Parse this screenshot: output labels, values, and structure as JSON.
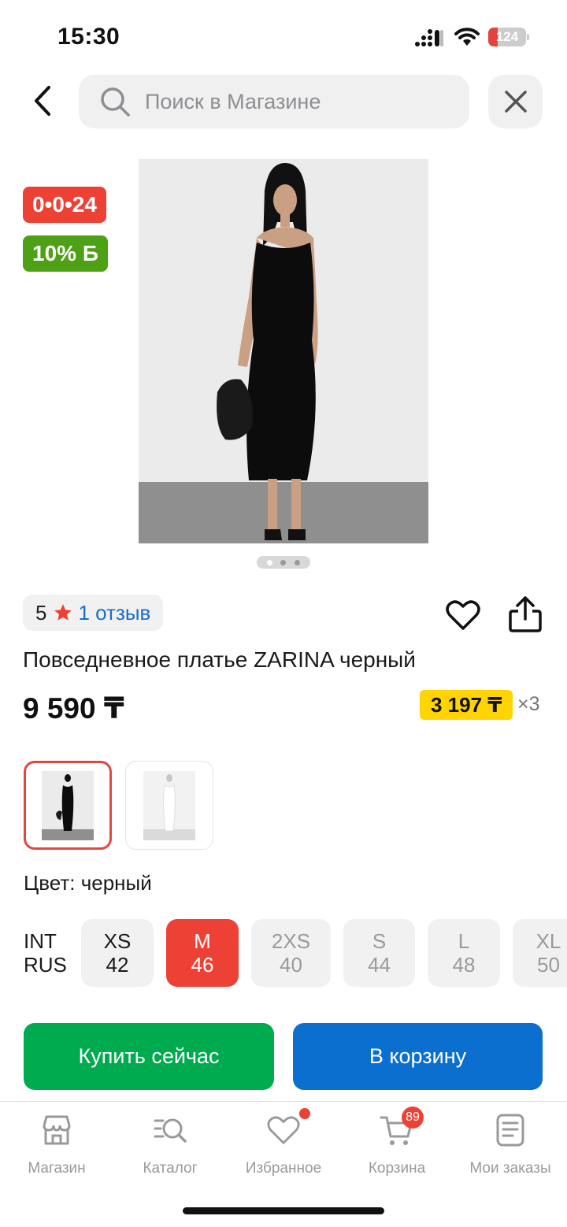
{
  "status_bar": {
    "time": "15:30",
    "battery": "124",
    "battery_level": 0.24
  },
  "search": {
    "placeholder": "Поиск в Магазине"
  },
  "badges": {
    "timer": "0•0•24",
    "bonus": "10% Б"
  },
  "rating": {
    "score": "5",
    "reviews": "1 отзыв"
  },
  "product": {
    "title": "Повседневное платье ZARINA черный",
    "price": "9 590 ₸",
    "installment": "3 197 ₸",
    "installment_multiplier": "×3",
    "color_label": "Цвет: черный"
  },
  "sizes": {
    "scale_int": "INT",
    "scale_rus": "RUS",
    "items": [
      {
        "int": "XS",
        "rus": "42",
        "state": "available"
      },
      {
        "int": "M",
        "rus": "46",
        "state": "selected"
      },
      {
        "int": "2XS",
        "rus": "40",
        "state": "unavailable"
      },
      {
        "int": "S",
        "rus": "44",
        "state": "unavailable"
      },
      {
        "int": "L",
        "rus": "48",
        "state": "unavailable"
      },
      {
        "int": "XL",
        "rus": "50",
        "state": "unavailable"
      }
    ]
  },
  "actions": {
    "buy_now": "Купить сейчас",
    "add_to_cart": "В корзину"
  },
  "tabbar": {
    "items": [
      {
        "label": "Магазин",
        "icon": "store-icon"
      },
      {
        "label": "Каталог",
        "icon": "catalog-search-icon"
      },
      {
        "label": "Избранное",
        "icon": "heart-icon"
      },
      {
        "label": "Корзина",
        "icon": "cart-icon",
        "badge": "89"
      },
      {
        "label": "Мои заказы",
        "icon": "orders-icon"
      }
    ]
  },
  "colors": {
    "accent_red": "#ee4136",
    "bonus_green": "#4ea114",
    "buy_green": "#00aa4e",
    "cart_blue": "#0a6fcf",
    "installment_yellow": "#ffd400",
    "link_blue": "#1b6ec2"
  }
}
